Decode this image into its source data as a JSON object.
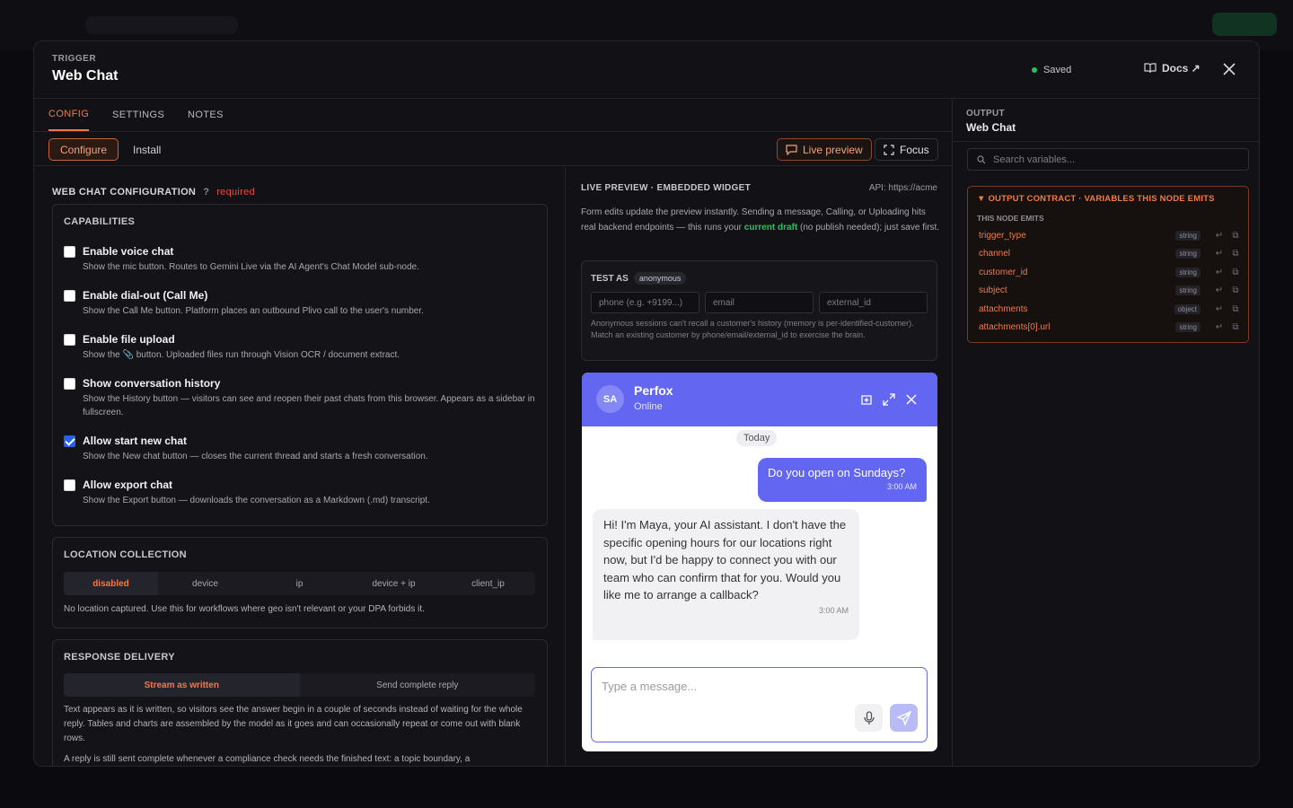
{
  "header": {
    "kicker": "TRIGGER",
    "title": "Web Chat",
    "status": "Saved",
    "docs_label": "Docs ↗",
    "status_color": "#22c55e"
  },
  "tabs": [
    "CONFIG",
    "SETTINGS",
    "NOTES"
  ],
  "subbar": {
    "configure": "Configure",
    "install": "Install",
    "live_preview": "Live preview",
    "focus": "Focus"
  },
  "config": {
    "heading": "WEB CHAT CONFIGURATION",
    "help": "?",
    "required": "required",
    "capabilities": {
      "title": "CAPABILITIES",
      "items": [
        {
          "label": "Enable voice chat",
          "desc": "Show the mic button. Routes to Gemini Live via the AI Agent's Chat Model sub-node.",
          "checked": false
        },
        {
          "label": "Enable dial-out (Call Me)",
          "desc": "Show the Call Me button. Platform places an outbound Plivo call to the user's number.",
          "checked": false
        },
        {
          "label": "Enable file upload",
          "desc": "Show the 📎 button. Uploaded files run through Vision OCR / document extract.",
          "checked": false
        },
        {
          "label": "Show conversation history",
          "desc": "Show the History button — visitors can see and reopen their past chats from this browser. Appears as a sidebar in fullscreen.",
          "checked": false
        },
        {
          "label": "Allow start new chat",
          "desc": "Show the New chat button — closes the current thread and starts a fresh conversation.",
          "checked": true
        },
        {
          "label": "Allow export chat",
          "desc": "Show the Export button — downloads the conversation as a Markdown (.md) transcript.",
          "checked": false
        }
      ]
    },
    "location": {
      "title": "LOCATION COLLECTION",
      "options": [
        "disabled",
        "device",
        "ip",
        "device + ip",
        "client_ip"
      ],
      "selected": "disabled",
      "note": "No location captured. Use this for workflows where geo isn't relevant or your DPA forbids it."
    },
    "delivery": {
      "title": "RESPONSE DELIVERY",
      "options": [
        "Stream as written",
        "Send complete reply"
      ],
      "selected": "Stream as written",
      "note1": "Text appears as it is written, so visitors see the answer begin in a couple of seconds instead of waiting for the whole reply. Tables and charts are assembled by the model as it goes and can occasionally repeat or come out with blank rows.",
      "note2": "A reply is still sent complete whenever a compliance check needs the finished text: a topic boundary, a"
    }
  },
  "preview": {
    "heading": "LIVE PREVIEW · EMBEDDED WIDGET",
    "api": "API: https://acme",
    "desc_a": "Form edits update the preview instantly. Sending a message, Calling, or Uploading hits real backend endpoints — this runs your ",
    "desc_b": "current draft",
    "desc_c": " (no publish needed); just save first.",
    "test_as": "TEST AS",
    "test_pill": "anonymous",
    "phone_ph": "phone (e.g. +9199...)",
    "email_ph": "email",
    "ext_ph": "external_id",
    "test_note": "Anonymous sessions can't recall a customer's history (memory is per-identified-customer). Match an existing customer by phone/email/external_id to exercise the brain."
  },
  "widget": {
    "avatar": "SA",
    "name": "Perfox",
    "status": "Online",
    "day": "Today",
    "out_msg": "Do you open on Sundays?",
    "out_time": "3:00 AM",
    "in_msg": "Hi! I'm Maya, your AI assistant. I don't have the specific opening hours for our locations right now, but I'd be happy to connect you with our team who can confirm that for you. Would you like me to arrange a callback?",
    "in_time": "3:00 AM",
    "placeholder": "Type a message...",
    "accent": "#6366f1"
  },
  "output": {
    "kicker": "OUTPUT",
    "title": "Web Chat",
    "search_ph": "Search variables...",
    "contract_title": "▼ OUTPUT CONTRACT · VARIABLES THIS NODE EMITS",
    "emits_label": "THIS NODE EMITS",
    "vars": [
      {
        "name": "trigger_type",
        "type": "string"
      },
      {
        "name": "channel",
        "type": "string"
      },
      {
        "name": "customer_id",
        "type": "string"
      },
      {
        "name": "subject",
        "type": "string"
      },
      {
        "name": "attachments",
        "type": "object"
      },
      {
        "name": "attachments[0].url",
        "type": "string"
      }
    ]
  }
}
